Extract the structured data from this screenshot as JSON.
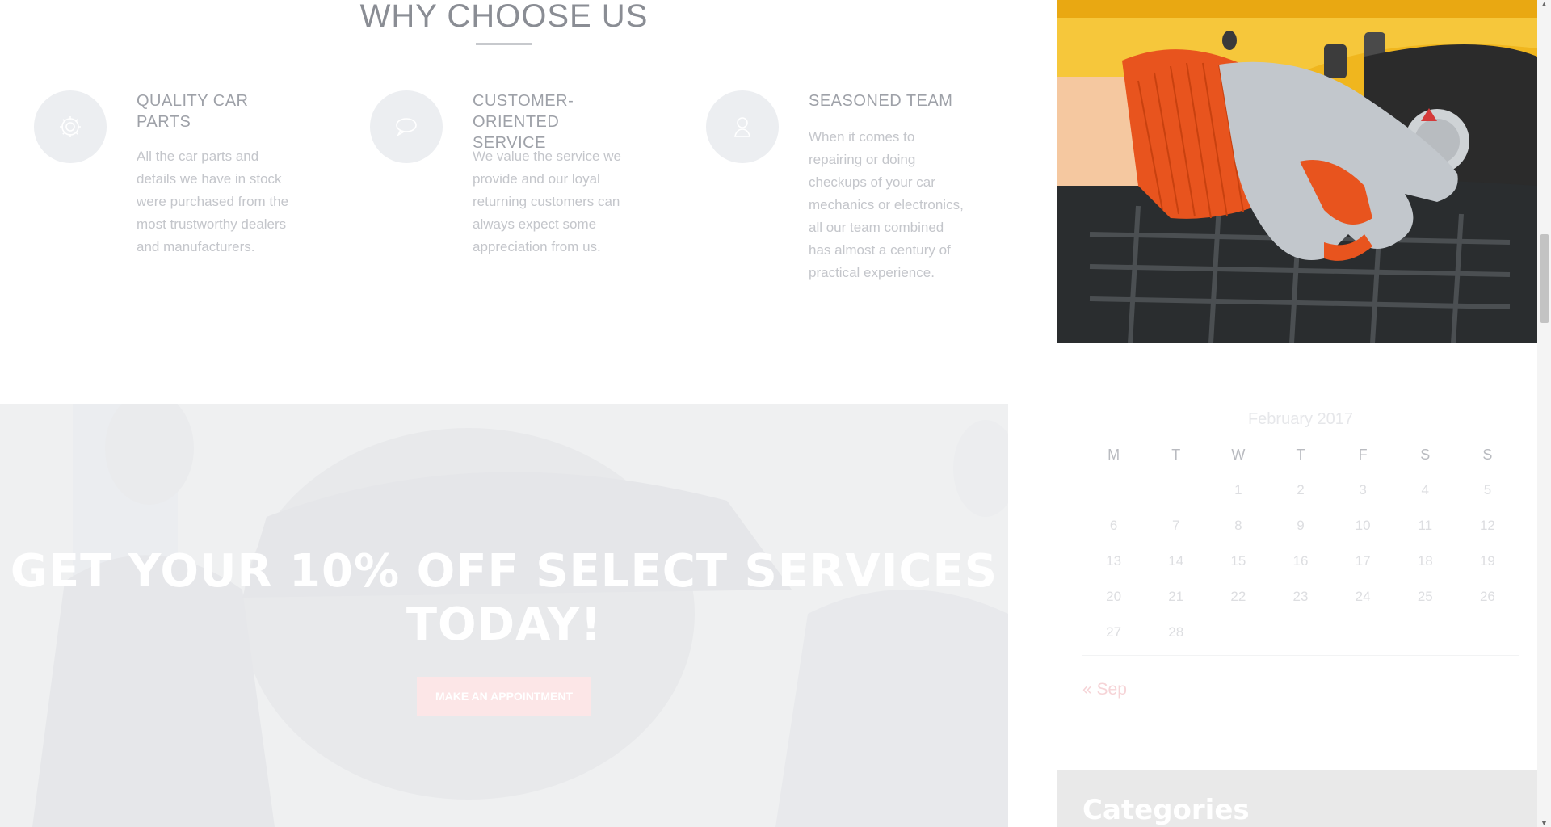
{
  "why_section": {
    "title": "WHY CHOOSE US",
    "features": [
      {
        "icon": "gear-icon",
        "title": "QUALITY CAR PARTS",
        "body": "All the car parts and details we have in stock were purchased from the most trustworthy dealers and manufacturers."
      },
      {
        "icon": "speech-bubble-icon",
        "title": "CUSTOMER-ORIENTED SERVICE",
        "body": "We value the service we provide and our loyal returning customers can always expect some appreciation from us."
      },
      {
        "icon": "person-icon",
        "title": "SEASONED TEAM",
        "body": "When it comes to repairing or doing checkups of your car mechanics or electronics, all our team combined has almost a century of practical experience."
      }
    ]
  },
  "promo": {
    "title": "GET YOUR 10% OFF SELECT SERVICES TODAY!",
    "button_label": "MAKE AN APPOINTMENT"
  },
  "sidebar": {
    "calendar": {
      "caption": "February 2017",
      "weekdays": [
        "M",
        "T",
        "W",
        "T",
        "F",
        "S",
        "S"
      ],
      "weeks": [
        [
          "",
          "",
          "1",
          "2",
          "3",
          "4",
          "5"
        ],
        [
          "6",
          "7",
          "8",
          "9",
          "10",
          "11",
          "12"
        ],
        [
          "13",
          "14",
          "15",
          "16",
          "17",
          "18",
          "19"
        ],
        [
          "20",
          "21",
          "22",
          "23",
          "24",
          "25",
          "26"
        ],
        [
          "27",
          "28",
          "",
          "",
          "",
          "",
          ""
        ]
      ],
      "prev_link": "« Sep"
    },
    "categories_title": "Categories"
  },
  "colors": {
    "accent": "#f6d4d7",
    "photo_car_yellow": "#f2b91c",
    "glove_orange": "#e8541e"
  }
}
